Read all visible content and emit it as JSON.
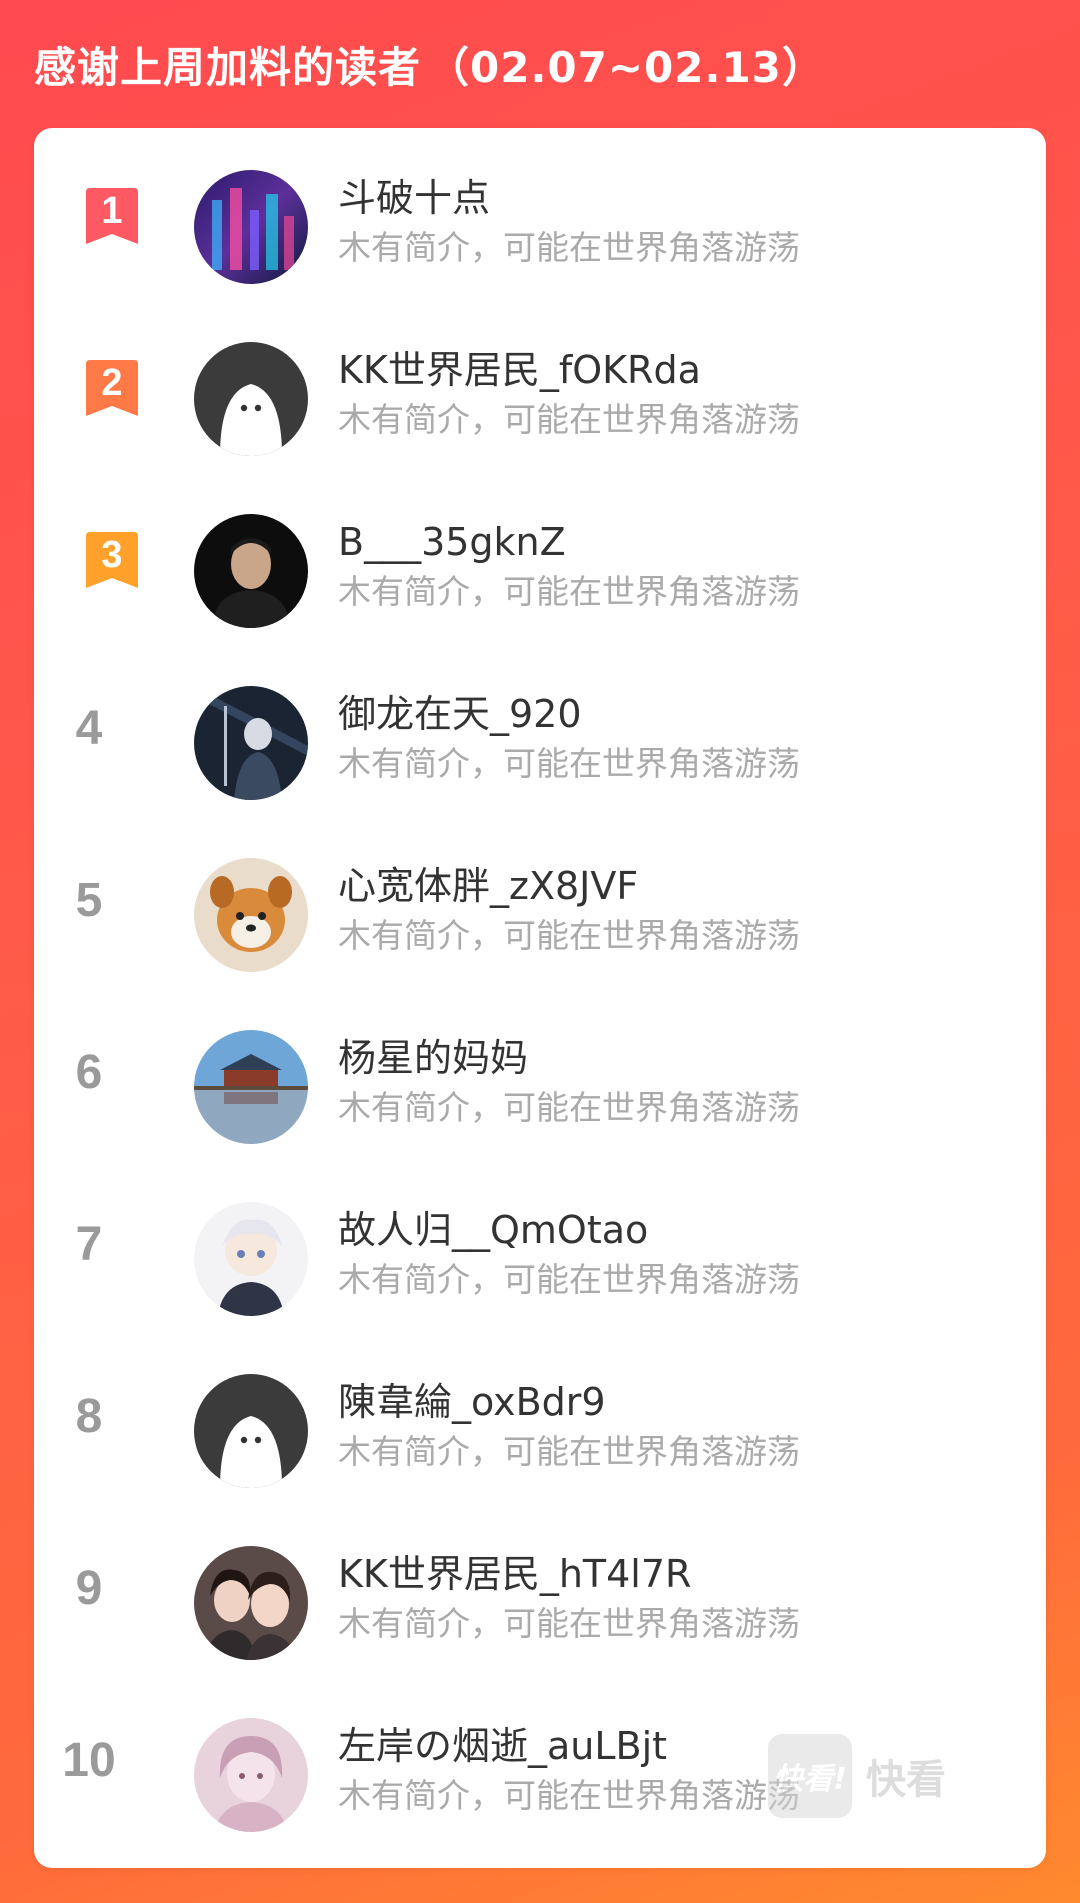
{
  "header": {
    "title": "感谢上周加料的读者",
    "range": "（02.07~02.13）"
  },
  "colors": {
    "rank1": "#ff5a63",
    "rank2": "#ff7a47",
    "rank3": "#ffa12b",
    "rank_default": "#9a9a9a"
  },
  "readers": [
    {
      "rank": "1",
      "name": "斗破十点",
      "bio": "木有简介，可能在世界角落游荡",
      "avatar": "city-night"
    },
    {
      "rank": "2",
      "name": "KK世界居民_fOKRda",
      "bio": "木有简介，可能在世界角落游荡",
      "avatar": "default-ghost"
    },
    {
      "rank": "3",
      "name": "B___35gknZ",
      "bio": "木有简介，可能在世界角落游荡",
      "avatar": "portrait-dark"
    },
    {
      "rank": "4",
      "name": "御龙在天_920",
      "bio": "木有简介，可能在世界角落游荡",
      "avatar": "anime-dark"
    },
    {
      "rank": "5",
      "name": "心宽体胖_zX8JVF",
      "bio": "木有简介，可能在世界角落游荡",
      "avatar": "plush-dog"
    },
    {
      "rank": "6",
      "name": "杨星的妈妈",
      "bio": "木有简介，可能在世界角落游荡",
      "avatar": "palace-scene"
    },
    {
      "rank": "7",
      "name": "故人归__QmOtao",
      "bio": "木有简介，可能在世界角落游荡",
      "avatar": "anime-light"
    },
    {
      "rank": "8",
      "name": "陳韋綸_oxBdr9",
      "bio": "木有简介，可能在世界角落游荡",
      "avatar": "default-ghost"
    },
    {
      "rank": "9",
      "name": "KK世界居民_hT4l7R",
      "bio": "木有简介，可能在世界角落游荡",
      "avatar": "two-girls"
    },
    {
      "rank": "10",
      "name": "左岸の烟逝_auLBjt",
      "bio": "木有简介，可能在世界角落游荡",
      "avatar": "anime-pink"
    }
  ],
  "watermark": {
    "logo_text": "快看!",
    "brand": "快看"
  }
}
